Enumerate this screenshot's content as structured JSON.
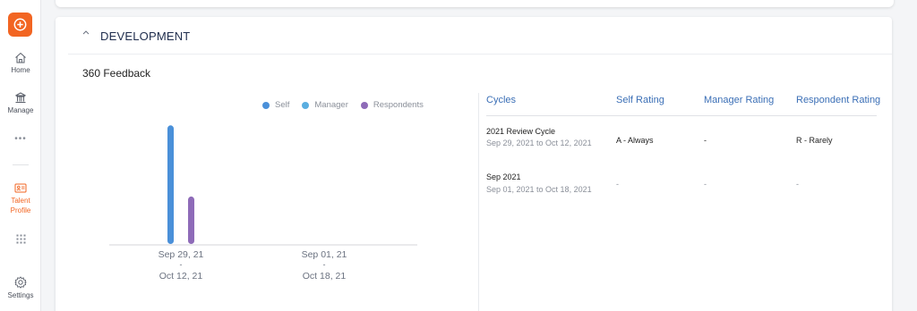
{
  "sidebar": {
    "items": [
      {
        "label": "Home",
        "icon": "home-icon"
      },
      {
        "label": "Manage",
        "icon": "bank-icon"
      },
      {
        "label": "Talent Profile",
        "icon": "id-card-icon"
      },
      {
        "label": "Settings",
        "icon": "gear-icon"
      }
    ],
    "more_label": "•••",
    "grid_icon": "grid-icon",
    "add_icon": "add-circle-icon",
    "accent": "#f26522"
  },
  "section": {
    "title": "DEVELOPMENT",
    "subtitle": "360 Feedback"
  },
  "chart_data": {
    "type": "bar",
    "legend": [
      {
        "name": "Self",
        "color": "#4a90d9"
      },
      {
        "name": "Manager",
        "color": "#5aaee0"
      },
      {
        "name": "Respondents",
        "color": "#8e6bb8"
      }
    ],
    "legend_placement": "top-right",
    "categories": [
      {
        "line1": "Sep 29, 21",
        "sep": "-",
        "line2": "Oct 12, 21"
      },
      {
        "line1": "Sep 01, 21",
        "sep": "-",
        "line2": "Oct 18, 21"
      }
    ],
    "series": [
      {
        "name": "Self",
        "color": "#4a90d9",
        "values": [
          5,
          0
        ]
      },
      {
        "name": "Respondents",
        "color": "#8e6bb8",
        "values": [
          2,
          0
        ]
      }
    ],
    "ylim": [
      0,
      5.2
    ],
    "grid": false
  },
  "table": {
    "headers": [
      "Cycles",
      "Self Rating",
      "Manager Rating",
      "Respondent Rating"
    ],
    "rows": [
      {
        "name": "2021 Review Cycle",
        "dates": "Sep 29, 2021 to Oct 12, 2021",
        "self": "A - Always",
        "manager": "-",
        "respondent": "R - Rarely"
      },
      {
        "name": "Sep 2021",
        "dates": "Sep 01, 2021 to Oct 18, 2021",
        "self": "-",
        "manager": "-",
        "respondent": "-"
      }
    ]
  }
}
